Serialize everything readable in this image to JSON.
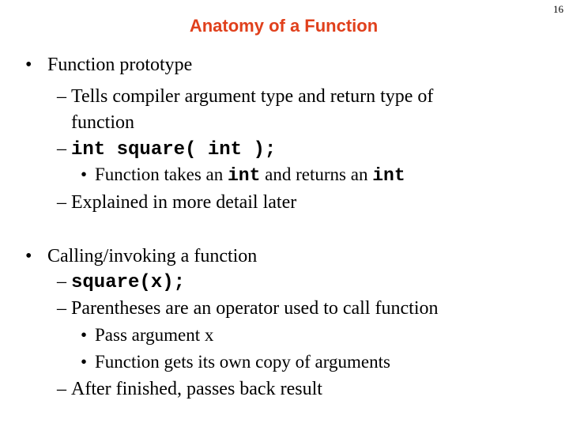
{
  "slide": {
    "title": "Anatomy of a Function",
    "page_number": "16",
    "title_color": "#e0401c",
    "sections": [
      {
        "bullet": "Function prototype",
        "items": [
          {
            "text_line1": "Tells compiler argument type and return type of",
            "text_line2": "function"
          },
          {
            "code": "int square( int );",
            "subitems": [
              {
                "parts": [
                  "Function takes an ",
                  "int",
                  " and returns an ",
                  "int"
                ]
              }
            ]
          },
          {
            "text": "Explained in more detail later"
          }
        ]
      },
      {
        "bullet": "Calling/invoking a function",
        "items": [
          {
            "code": "square(x);"
          },
          {
            "text": "Parentheses are an operator used to call function",
            "subitems": [
              {
                "text": "Pass argument x"
              },
              {
                "text": "Function gets its own copy of arguments"
              }
            ]
          },
          {
            "text": "After finished, passes back result"
          }
        ]
      }
    ],
    "glyphs": {
      "bullet": "•",
      "dash": "–"
    }
  }
}
